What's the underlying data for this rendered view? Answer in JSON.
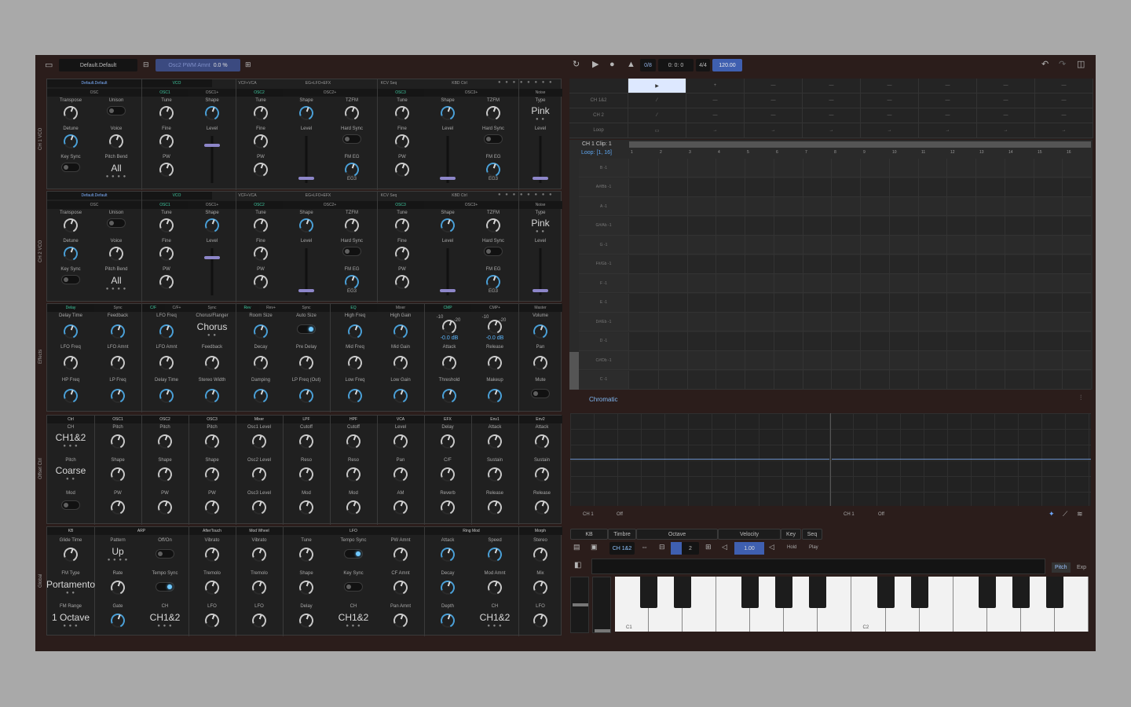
{
  "topbar": {
    "preset": "Default.Default",
    "param": "Osc2 PWM Amnt",
    "param_val": "0.0 %",
    "pattern": "0/8",
    "pos": "0: 0: 0",
    "sig": "4/4",
    "tempo": "120.00"
  },
  "synth": {
    "ch1_label": "CH 1 VCO",
    "ch2_label": "CH 2 VCO",
    "effects_label": "Effects",
    "offset_label": "Offset Ctrl",
    "global_label": "Global",
    "tabs": {
      "preset": "Default.Default",
      "vco": "VCO",
      "vcf": "VCF+VCA",
      "eg": "EG+LFO+EFX",
      "kcv": "KCV Seq",
      "kbd": "KBD Ctrl"
    },
    "sub": {
      "osc": "OSC",
      "osc1": "OSC1",
      "osc1p": "OSC1+",
      "osc2": "OSC2",
      "osc2p": "OSC2+",
      "osc3": "OSC3",
      "osc3p": "OSC3+",
      "noise": "Noise"
    },
    "lab": {
      "transpose": "Transpose",
      "unison": "Unison",
      "detune": "Detune",
      "voice": "Voice",
      "keysync": "Key Sync",
      "pitchbend": "Pitch Bend",
      "all": "All",
      "tune": "Tune",
      "shape": "Shape",
      "fine": "Fine",
      "level": "Level",
      "pw": "PW",
      "tzfm": "TZFM",
      "hardsync": "Hard Sync",
      "fmeg": "FM EG",
      "eg3": "EG3",
      "type": "Type",
      "pink": "Pink"
    },
    "fx": {
      "delay": "Delay",
      "sync": "Sync",
      "cf": "C/F",
      "cfp": "C/F+",
      "rev": "Rev",
      "revp": "Rev+",
      "eq": "EQ",
      "mixer": "Mixer",
      "cmp": "CMP",
      "cmpp": "CMP+",
      "master": "Master",
      "delaytime": "Delay Time",
      "feedback": "Feedback",
      "lfofreq": "LFO Freq",
      "lfoamnt": "LFO Amnt",
      "hpfreq": "HP Freq",
      "lpfreq": "LP Freq",
      "chorusflanger": "Chorus/Flanger",
      "chorus": "Chorus",
      "stereowidth": "Stereo Width",
      "roomsize": "Room Size",
      "autosize": "Auto Size",
      "decay": "Decay",
      "predelay": "Pre Delay",
      "damping": "Damping",
      "lpfreqout": "LP Freq (Out)",
      "highfreq": "High Freq",
      "highgain": "High Gain",
      "midfreq": "Mid Freq",
      "midgain": "Mid Gain",
      "lowfreq": "Low Freq",
      "lowgain": "Low Gain",
      "attack": "Attack",
      "release": "Release",
      "threshold": "Threshold",
      "makeup": "Makeup",
      "volume": "Volume",
      "pan": "Pan",
      "mute": "Mute",
      "db1": "-0.0 dB",
      "db2": "-0.0 dB",
      "m10": "-10",
      "m20": "-20"
    },
    "off": {
      "ctrl": "Ctrl",
      "osc1": "OSC1",
      "osc2": "OSC2",
      "osc3": "OSC3",
      "mixer": "Mixer",
      "lpf": "LPF",
      "hpf": "HPF",
      "vca": "VCA",
      "efx": "EFX",
      "env1": "Env1",
      "env2": "Env2",
      "ch": "CH",
      "ch12": "CH1&2",
      "pitch": "Pitch",
      "coarse": "Coarse",
      "mod": "Mod",
      "shape": "Shape",
      "pw": "PW",
      "osc1level": "Osc1 Level",
      "osc2level": "Osc2 Level",
      "osc3level": "Osc3 Level",
      "cutoff": "Cutoff",
      "reso": "Reso",
      "level": "Level",
      "pan": "Pan",
      "am": "AM",
      "delay": "Delay",
      "cf": "C/F",
      "reverb": "Reverb",
      "attack": "Attack",
      "sustain": "Sustain",
      "release": "Release"
    },
    "glob": {
      "kb": "KB",
      "arp": "ARP",
      "aftertouch": "AfterTouch",
      "modwheel": "Mod Wheel",
      "lfo": "LFO",
      "ringmod": "Ring Mod",
      "morph": "Morph",
      "glidetime": "Glide Time",
      "fmtype": "FM Type",
      "portamento": "Portamento",
      "fmrange": "FM Range",
      "octave": "1 Octave",
      "pattern": "Pattern",
      "up": "Up",
      "offon": "Off/On",
      "rate": "Rate",
      "temposync": "Tempo Sync",
      "gate": "Gate",
      "ch": "CH",
      "ch12": "CH1&2",
      "vibrato": "Vibrato",
      "tremolo": "Tremolo",
      "lfo_l": "LFO",
      "tune": "Tune",
      "shape": "Shape",
      "delay": "Delay",
      "keysync": "Key Sync",
      "pwamnt": "PW Amnt",
      "cfamnt": "CF Amnt",
      "panamnt": "Pan Amnt",
      "attack": "Attack",
      "decay": "Decay",
      "depth": "Depth",
      "speed": "Speed",
      "modamnt": "Mod Amnt",
      "stereo": "Stereo",
      "mix": "Mix"
    }
  },
  "seq": {
    "rows": [
      "CH 1&2",
      "CH 2",
      "Loop"
    ],
    "clip": "CH 1 Clip: 1",
    "loop": "Loop: [1, 16]",
    "notes": [
      "B -1",
      "A#/Bb -1",
      "A -1",
      "G#/Ab -1",
      "G -1",
      "F#/Gb -1",
      "F -1",
      "E -1",
      "D#/Eb -1",
      "D -1",
      "C#/Db -1",
      "C -1"
    ],
    "steps": [
      "1",
      "2",
      "3",
      "4",
      "5",
      "6",
      "7",
      "8",
      "9",
      "10",
      "11",
      "12",
      "13",
      "14",
      "15",
      "16"
    ],
    "scale": "Chromatic",
    "ch1": "CH 1",
    "off1": "Off",
    "ch1b": "CH 1",
    "off2": "Off"
  },
  "kb": {
    "tabs": [
      "KB",
      "Timbre",
      "Octave",
      "Velocity",
      "Key",
      "Seq"
    ],
    "channel": "CH 1&2",
    "octave": "2",
    "velocity": "1.00",
    "hold": "Hold",
    "play": "Play",
    "pitch": "Pitch",
    "exp": "Exp",
    "c1": "C1",
    "c2": "C2"
  }
}
